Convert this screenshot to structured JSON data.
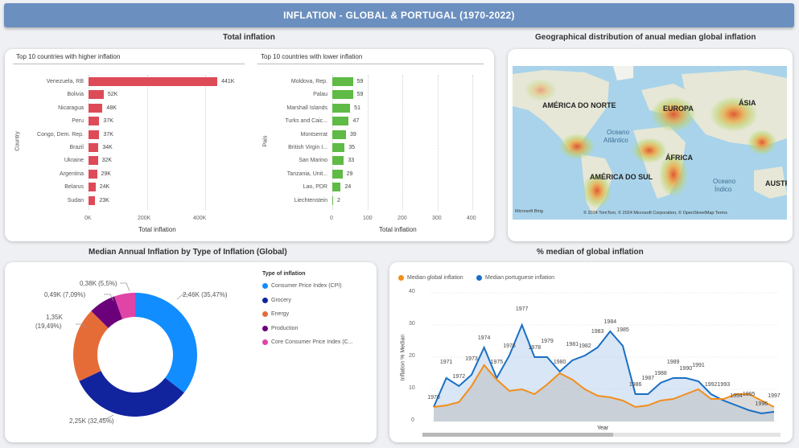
{
  "header": {
    "title": "INFLATION - GLOBAL & PORTUGAL (1970-2022)"
  },
  "total": {
    "title": "Total inflation",
    "higher": {
      "subtitle": "Top 10 countries with higher inflation",
      "ytitle": "Country",
      "xtitle": "Total inflation",
      "ticks": [
        "0K",
        "200K",
        "400K"
      ]
    },
    "lower": {
      "subtitle": "Top 10 countries with lower inflation",
      "ytitle": "País",
      "xtitle": "Total inflation",
      "ticks": [
        "0",
        "100",
        "200",
        "300",
        "400"
      ]
    }
  },
  "map": {
    "title": "Geographical distribution of anual median global inflation",
    "labels": {
      "north_america": "AMÉRICA DO NORTE",
      "europe": "EUROPA",
      "asia": "ÁSIA",
      "ocean_atl_1": "Oceano",
      "ocean_atl_2": "Atlântico",
      "africa": "ÁFRICA",
      "south_america": "AMÉRICA DO SUL",
      "ocean_ind_1": "Oceano",
      "ocean_ind_2": "Índico",
      "australia": "AUSTR"
    },
    "attribution": "© 2024 TomTom, © 2024 Microsoft Corporation, © OpenStreetMap  Terms",
    "logo": "Microsoft Bing"
  },
  "donut": {
    "title": "Median Annual Inflation by Type of Inflation (Global)",
    "legend_title": "Type of inflation",
    "labels": {
      "cpi_1": "2,46K (35,47%)",
      "grocery_1": "2,25K (32,45%)",
      "energy_1": "1,35K",
      "energy_2": "(19,49%)",
      "production_1": "0,49K (7,09%)",
      "core_1": "0,38K (5,5%)"
    },
    "legend": [
      {
        "name": "Consumer Price Index (CPI)",
        "color": "#118dff"
      },
      {
        "name": "Grocery",
        "color": "#12239e"
      },
      {
        "name": "Energy",
        "color": "#e66c37"
      },
      {
        "name": "Production",
        "color": "#6b007b"
      },
      {
        "name": "Core Consumer Price Index (C...",
        "color": "#e044a7"
      }
    ]
  },
  "line": {
    "title": "% median of global inflation",
    "legend": [
      {
        "name": "Median global inflation",
        "color": "#f28e1c"
      },
      {
        "name": "Median portuguese inflation",
        "color": "#1a6fc4"
      }
    ],
    "ytitle": "Inflation % Median",
    "xtitle": "Year",
    "yticks": [
      "40",
      "30",
      "20",
      "10",
      "0"
    ]
  },
  "chart_data": [
    {
      "type": "bar",
      "title": "Top 10 countries with higher inflation",
      "xlabel": "Total inflation",
      "ylabel": "Country",
      "categories": [
        "Venezuela, RB",
        "Bolivia",
        "Nicaragua",
        "Peru",
        "Congo, Dem. Rep.",
        "Brazil",
        "Ukraine",
        "Argentina",
        "Belarus",
        "Sudan"
      ],
      "values": [
        441000,
        52000,
        48000,
        37000,
        37000,
        34000,
        32000,
        29000,
        24000,
        23000
      ],
      "value_labels": [
        "441K",
        "52K",
        "48K",
        "37K",
        "37K",
        "34K",
        "32K",
        "29K",
        "24K",
        "23K"
      ],
      "xlim": [
        0,
        460000
      ],
      "color": "#dd4b58"
    },
    {
      "type": "bar",
      "title": "Top 10 countries with lower inflation",
      "xlabel": "Total inflation",
      "ylabel": "País",
      "categories": [
        "Moldova, Rep.",
        "Palau",
        "Marshall Islands",
        "Turks and Caic...",
        "Montserrat",
        "British Virgin I...",
        "San Marino",
        "Tanzania, Unit...",
        "Lao, PDR",
        "Liechtenstein"
      ],
      "values": [
        59,
        59,
        51,
        47,
        39,
        35,
        33,
        29,
        24,
        2
      ],
      "xlim": [
        0,
        400
      ],
      "color": "#5fba46"
    },
    {
      "type": "pie",
      "title": "Median Annual Inflation by Type of Inflation (Global)",
      "categories": [
        "Consumer Price Index (CPI)",
        "Grocery",
        "Energy",
        "Production",
        "Core Consumer Price Index (C..."
      ],
      "values": [
        2460,
        2250,
        1350,
        490,
        380
      ],
      "percentages": [
        35.47,
        32.45,
        19.49,
        7.09,
        5.5
      ]
    },
    {
      "type": "area",
      "title": "% median of global inflation",
      "xlabel": "Year",
      "ylabel": "Inflation % Median",
      "x": [
        1970,
        1971,
        1972,
        1973,
        1974,
        1975,
        1976,
        1977,
        1978,
        1979,
        1980,
        1981,
        1982,
        1983,
        1984,
        1985,
        1986,
        1987,
        1988,
        1989,
        1990,
        1991,
        1992,
        1993,
        1994,
        1995,
        1996,
        1997
      ],
      "ylim": [
        0,
        40
      ],
      "series": [
        {
          "name": "Median global inflation",
          "values": [
            4.5,
            5,
            6,
            11,
            17.5,
            13,
            9.5,
            10,
            8.5,
            11.5,
            15,
            13,
            10,
            8,
            7.5,
            6.5,
            4.5,
            5,
            6.5,
            7,
            8.5,
            10,
            7,
            7,
            8.5,
            8.5,
            6.5,
            4.5
          ]
        },
        {
          "name": "Median portuguese inflation",
          "values": [
            4.5,
            13.5,
            11,
            14.5,
            23,
            13.5,
            20.5,
            30,
            20,
            20,
            15.5,
            19,
            20.5,
            23,
            28,
            23.5,
            8.5,
            8.5,
            12,
            13.5,
            13.5,
            12.5,
            8.5,
            6.5,
            5,
            3.5,
            2.5,
            3
          ]
        }
      ]
    }
  ]
}
